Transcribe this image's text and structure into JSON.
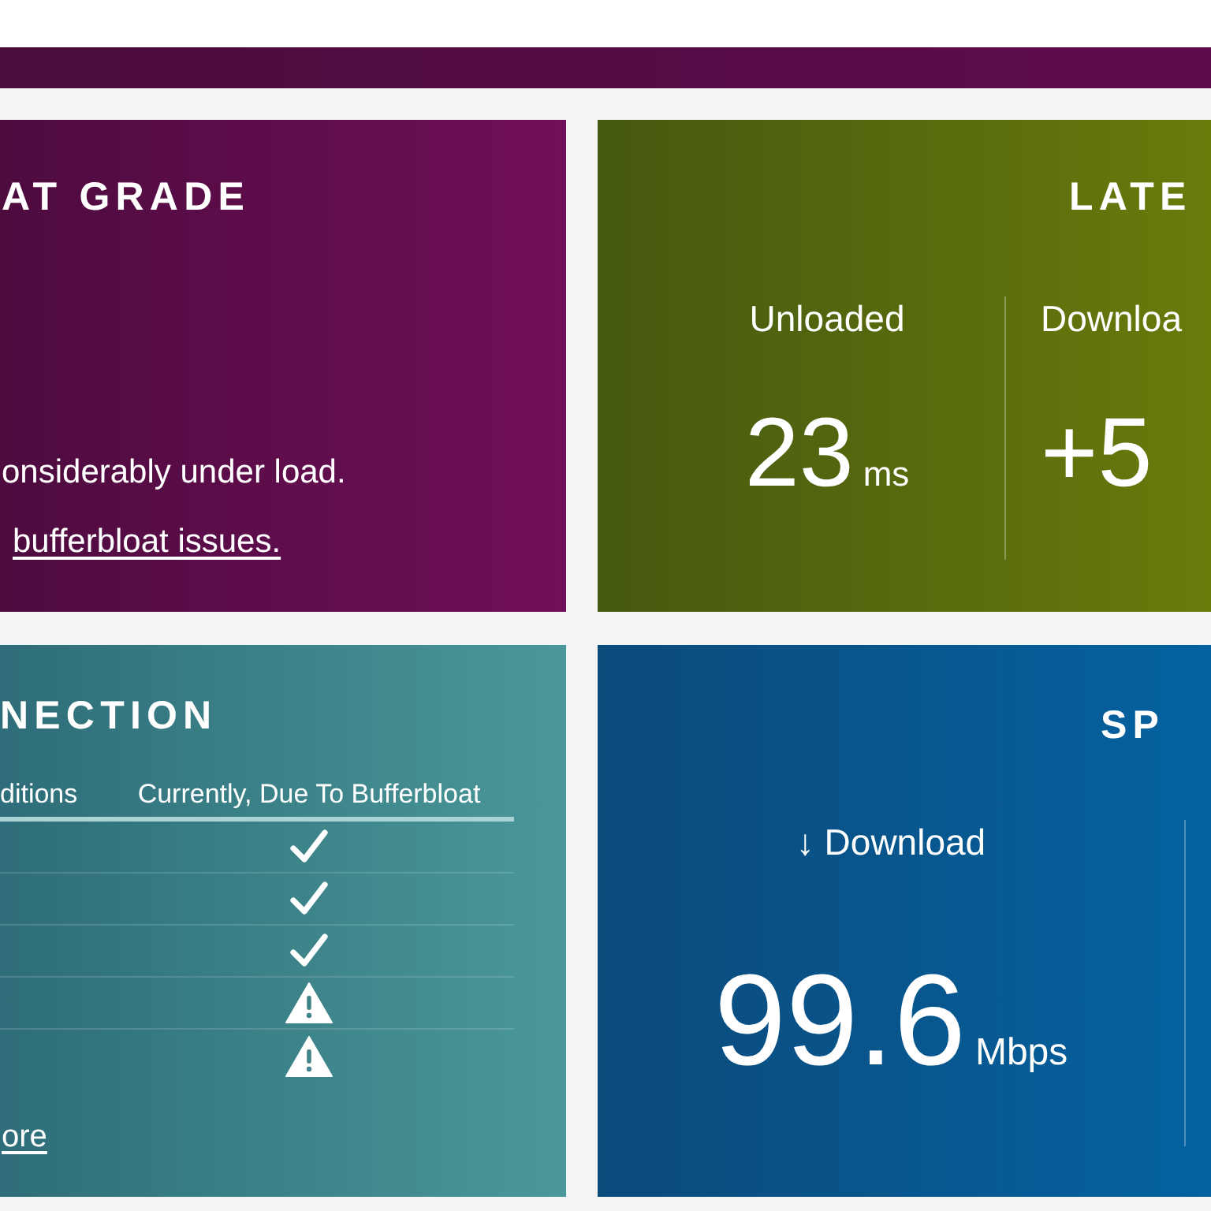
{
  "grade_card": {
    "title": "AT GRADE",
    "summary": "onsiderably under load.",
    "link": "bufferbloat issues."
  },
  "latency_card": {
    "title": "LATE",
    "metrics": [
      {
        "label": "Unloaded",
        "value": "23",
        "unit": "ms"
      },
      {
        "label": "Downloa",
        "value": "+5"
      }
    ]
  },
  "connection_card": {
    "title": "NECTION",
    "columns": [
      "ditions",
      "Currently, Due To Bufferbloat"
    ],
    "rows": [
      {
        "kind": "check"
      },
      {
        "kind": "check"
      },
      {
        "kind": "check"
      },
      {
        "kind": "warning"
      },
      {
        "kind": "warning"
      }
    ],
    "link": "ore"
  },
  "speed_card": {
    "title": "SP",
    "metrics": [
      {
        "label": "↓ Download",
        "value": "99.6",
        "unit": "Mbps"
      }
    ]
  }
}
